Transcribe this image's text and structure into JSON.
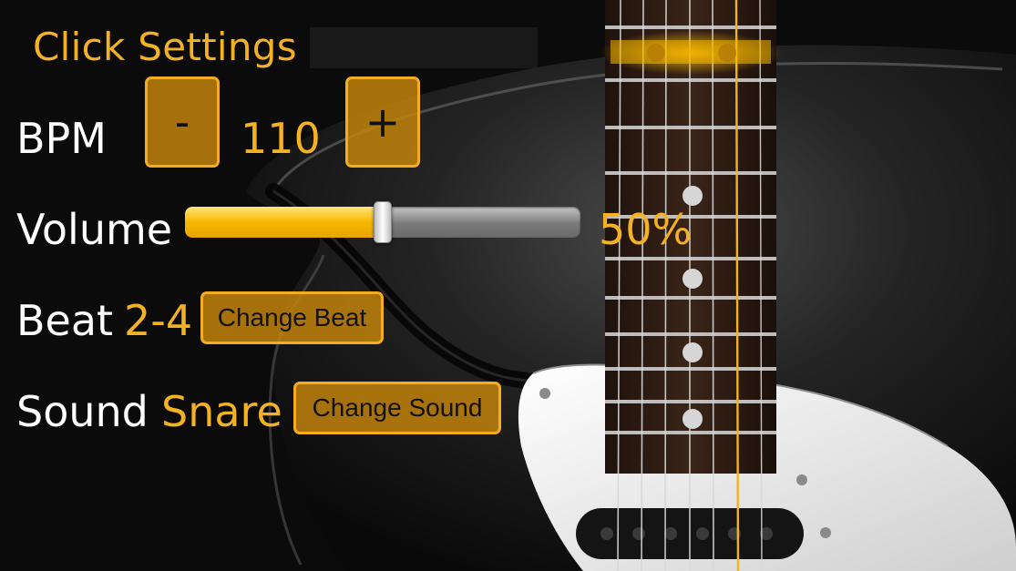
{
  "screen": {
    "title": "Click Settings",
    "bpm": {
      "label": "BPM",
      "value": "110",
      "decrement_label": "-",
      "increment_label": "+"
    },
    "volume": {
      "label": "Volume",
      "value_text": "50%",
      "level": 0.5
    },
    "beat": {
      "label": "Beat",
      "value": "2-4",
      "button_label": "Change Beat"
    },
    "sound": {
      "label": "Sound",
      "value": "Snare",
      "button_label": "Change Sound"
    }
  },
  "colors": {
    "accent": "#f2b224",
    "button_fill": "#c8870a",
    "button_border": "#f3ad1e",
    "slider_fill": "#f7b800",
    "text_primary": "#ffffff"
  },
  "background": {
    "image": "electric guitar body and fretboard with one glowing string"
  }
}
